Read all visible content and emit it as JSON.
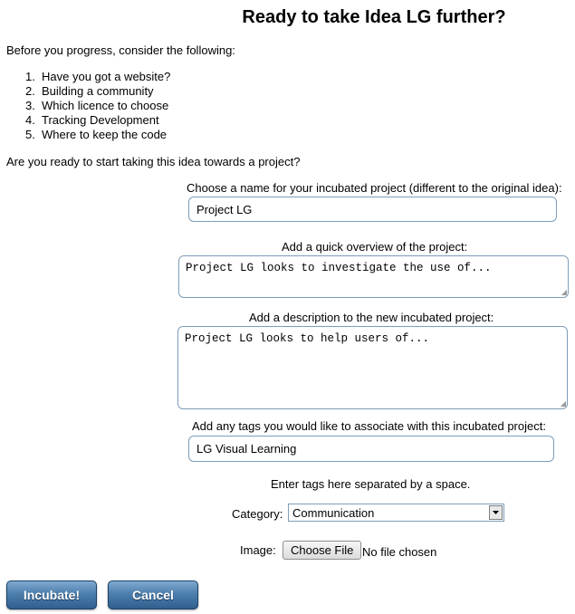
{
  "page": {
    "title": "Ready to take Idea LG further?",
    "intro": "Before you progress, consider the following:",
    "considerations": [
      {
        "num": "1.",
        "text": "Have you got a website?"
      },
      {
        "num": "2.",
        "text": "Building a community"
      },
      {
        "num": "3.",
        "text": "Which licence to choose"
      },
      {
        "num": "4.",
        "text": "Tracking Development"
      },
      {
        "num": "5.",
        "text": "Where to keep the code"
      }
    ],
    "question": "Are you ready to start taking this idea towards a project?"
  },
  "form": {
    "name_label": "Choose a name for your incubated project (different to the original idea):",
    "name_value": "Project LG",
    "overview_label": "Add a quick overview of the project:",
    "overview_value": "Project LG looks to investigate the use of...",
    "description_label": "Add a description to the new incubated project:",
    "description_value": "Project LG looks to help users of...",
    "tags_label": "Add any tags you would like to associate with this incubated project:",
    "tags_value": "LG Visual Learning",
    "tags_hint": "Enter tags here separated by a space.",
    "category_label": "Category:",
    "category_value": "Communication",
    "image_label": "Image:",
    "choose_file_label": "Choose File",
    "file_status": "No file chosen"
  },
  "actions": {
    "incubate_label": "Incubate!",
    "cancel_label": "Cancel"
  },
  "colors": {
    "field_border": "#7f9db9",
    "button_blue": "#4d7fad"
  }
}
